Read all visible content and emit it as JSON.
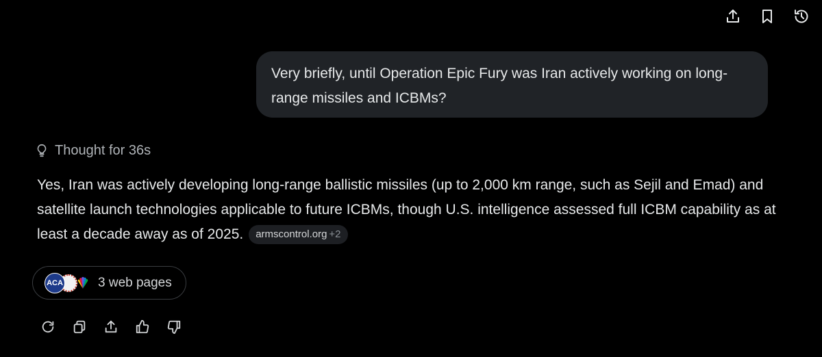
{
  "header": {
    "icons": [
      "share-icon",
      "bookmark-icon",
      "history-icon"
    ]
  },
  "user_message": {
    "text": "Very briefly, until Operation Epic Fury was Iran actively working on long-range missiles and ICBMs?"
  },
  "thought": {
    "icon": "lightbulb-icon",
    "label": "Thought for 36s"
  },
  "answer": {
    "text": "Yes, Iran was actively developing long-range ballistic missiles (up to 2,000 km range, such as Sejil and Emad) and satellite launch technologies applicable to future ICBMs, though U.S. intelligence assessed full ICBM capability as at least a decade away as of 2025.",
    "source_chip": {
      "domain": "armscontrol.org",
      "more": "+2"
    }
  },
  "sources": {
    "favicon_aca_text": "ACA",
    "label": "3 web pages"
  },
  "actions": {
    "icons": [
      "regenerate-icon",
      "copy-icon",
      "share-icon",
      "thumbs-up-icon",
      "thumbs-down-icon"
    ]
  },
  "colors": {
    "background": "#000000",
    "bubble": "#202327",
    "text": "#e7e9ea",
    "muted": "#b0b4b8"
  }
}
